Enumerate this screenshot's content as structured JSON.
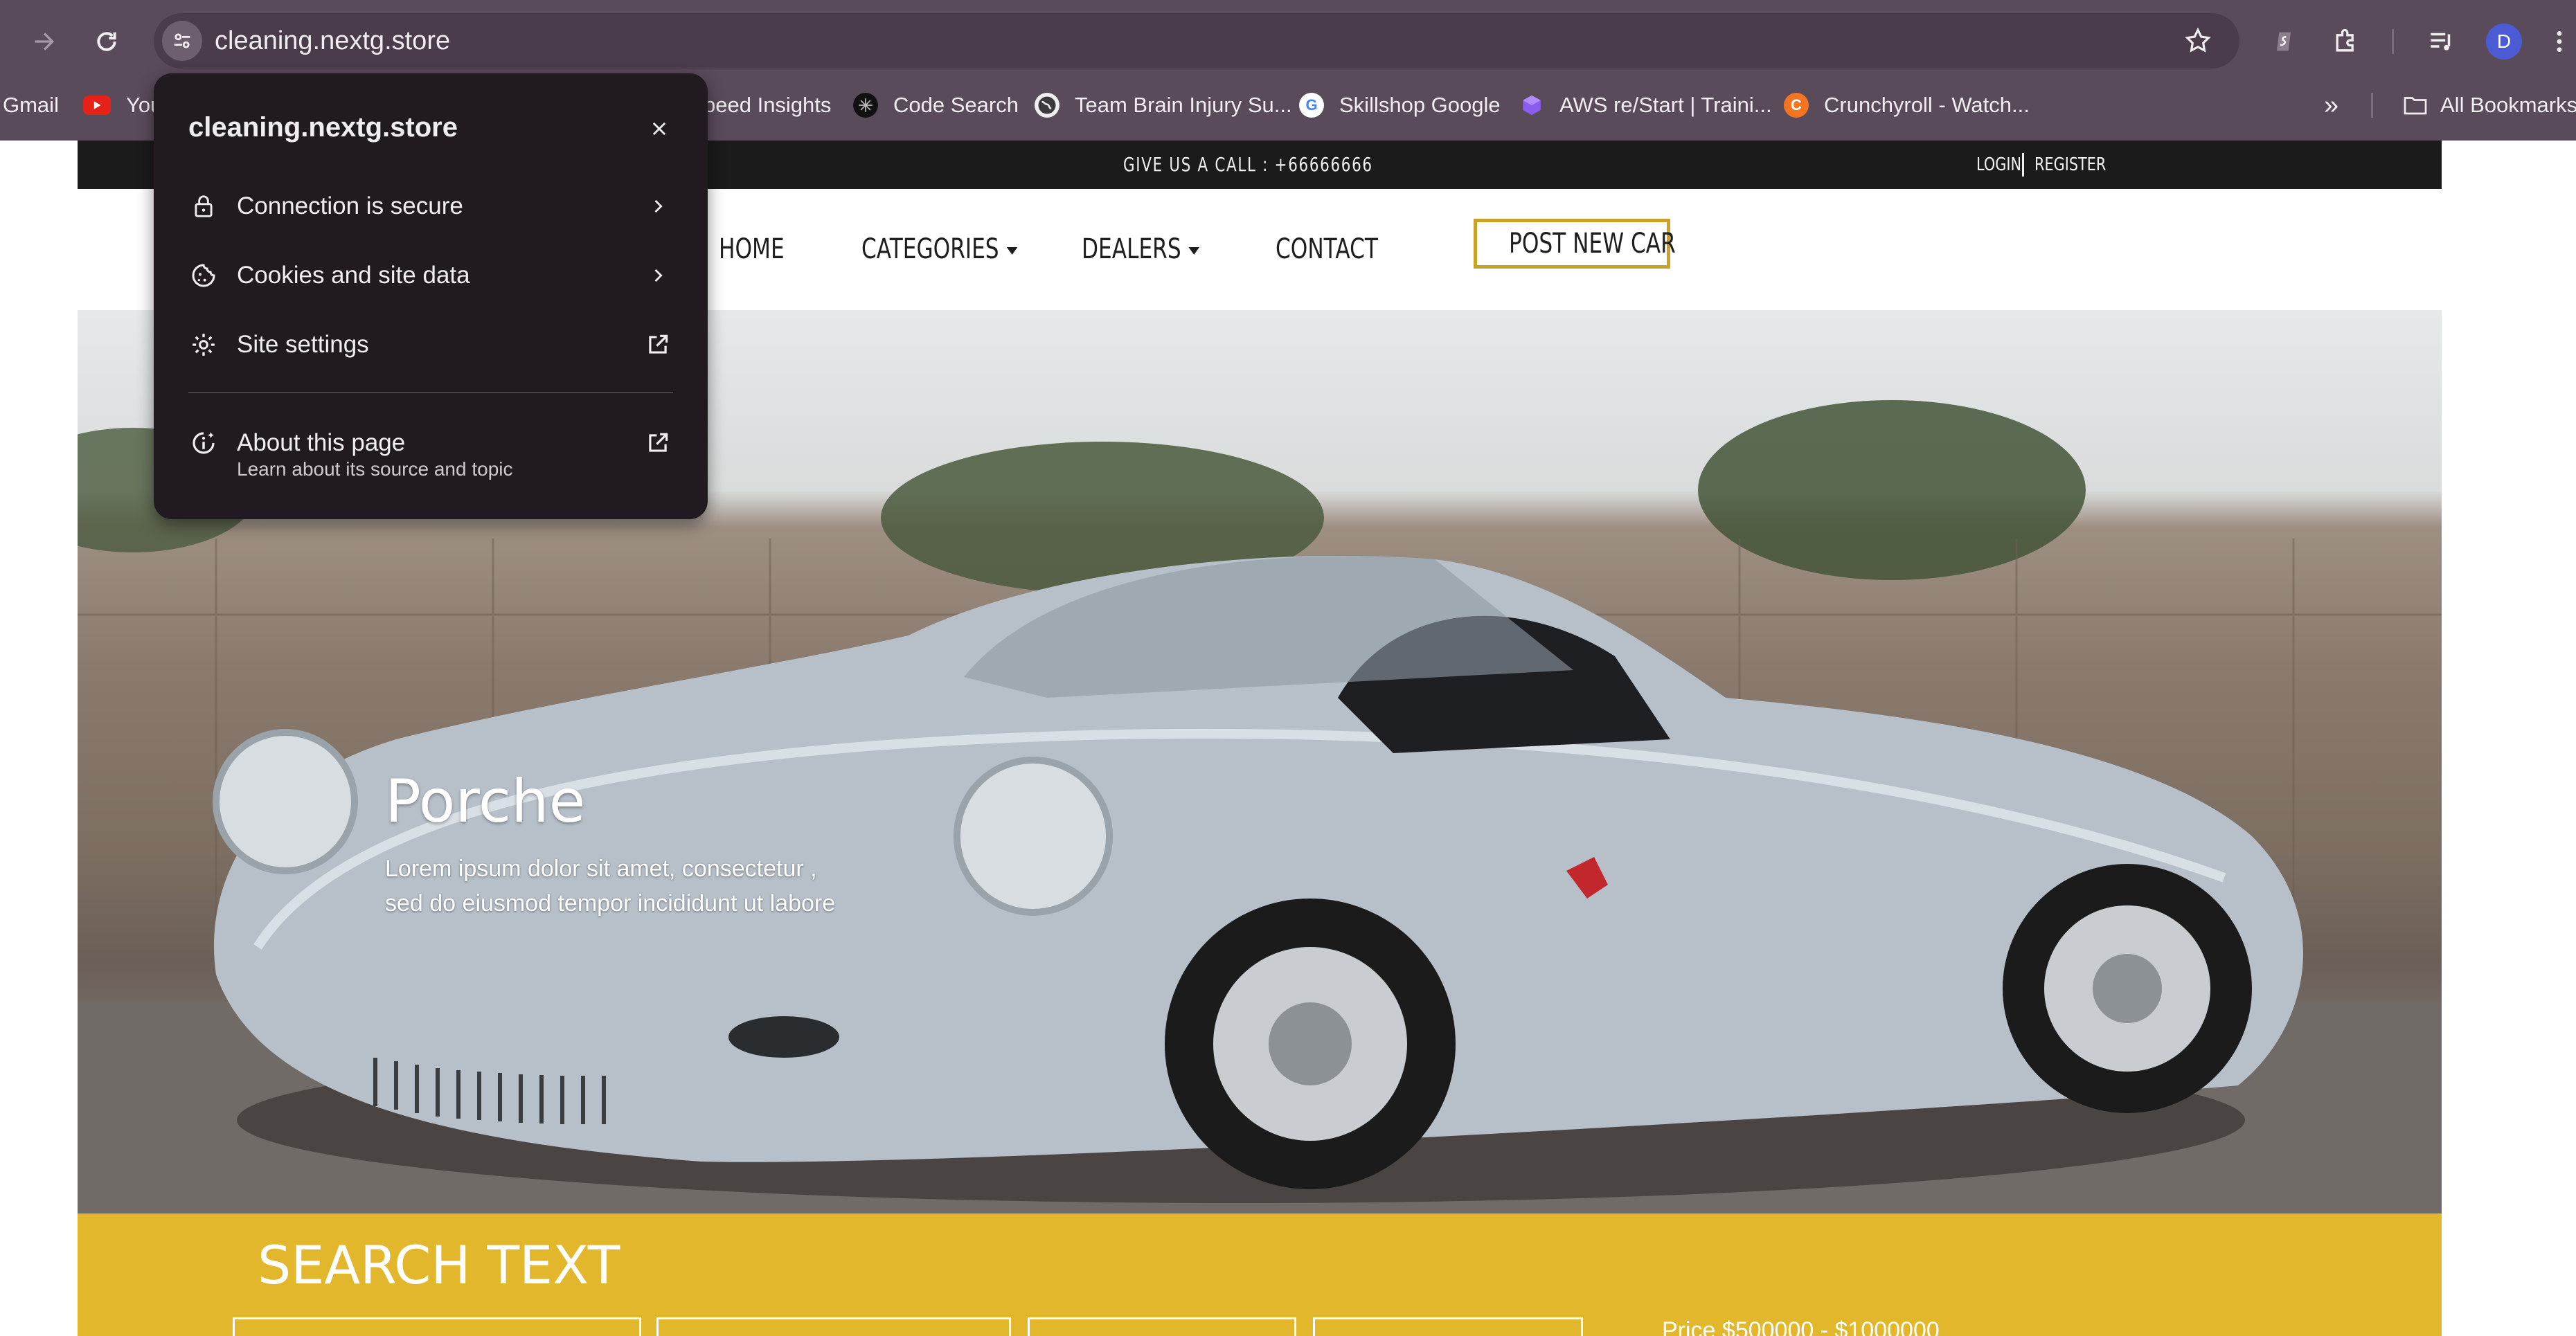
{
  "browser": {
    "url": "cleaning.nextg.store",
    "avatar_letter": "D",
    "bookmarks": [
      {
        "label": "Gmail",
        "icon": "gmail-icon"
      },
      {
        "label": "You",
        "icon": "youtube-icon"
      },
      {
        "label": "peed Insights",
        "icon": "pagespeed-icon"
      },
      {
        "label": "Code Search",
        "icon": "code-search-icon"
      },
      {
        "label": "Team Brain Injury Su...",
        "icon": "globe-icon"
      },
      {
        "label": "Skillshop Google",
        "icon": "google-icon"
      },
      {
        "label": "AWS re/Start | Traini...",
        "icon": "aws-icon"
      },
      {
        "label": "Crunchyroll - Watch...",
        "icon": "crunchyroll-icon"
      }
    ],
    "all_bookmarks": "All Bookmarks"
  },
  "site_info_popup": {
    "title": "cleaning.nextg.store",
    "items": [
      {
        "label": "Connection is secure",
        "icon": "lock-icon"
      },
      {
        "label": "Cookies and site data",
        "icon": "cookie-icon"
      },
      {
        "label": "Site settings",
        "icon": "gear-icon"
      }
    ],
    "about": {
      "label": "About this page",
      "sublabel": "Learn about its source and topic"
    }
  },
  "site": {
    "topbar": {
      "call": "GIVE US A CALL : +66666666",
      "login": "LOGIN",
      "register": "REGISTER"
    },
    "nav": {
      "home": "HOME",
      "categories": "CATEGORIES",
      "dealers": "DEALERS",
      "contact": "CONTACT",
      "post_new_car": "POST NEW CAR"
    },
    "hero": {
      "title": "Porche",
      "text_line1": "Lorem ipsum dolor sit amet, consectetur ,",
      "text_line2": "sed do eiusmod tempor incididunt ut labore"
    },
    "search": {
      "title": "SEARCH TEXT",
      "price": "Price  $500000 - $1000000"
    }
  },
  "colors": {
    "chrome_bg": "#5a4b5a",
    "popup_bg": "#211b21",
    "accent_gold": "#c9a227",
    "search_band": "#e2b72c",
    "topbar_bg": "#1b1b1b"
  }
}
